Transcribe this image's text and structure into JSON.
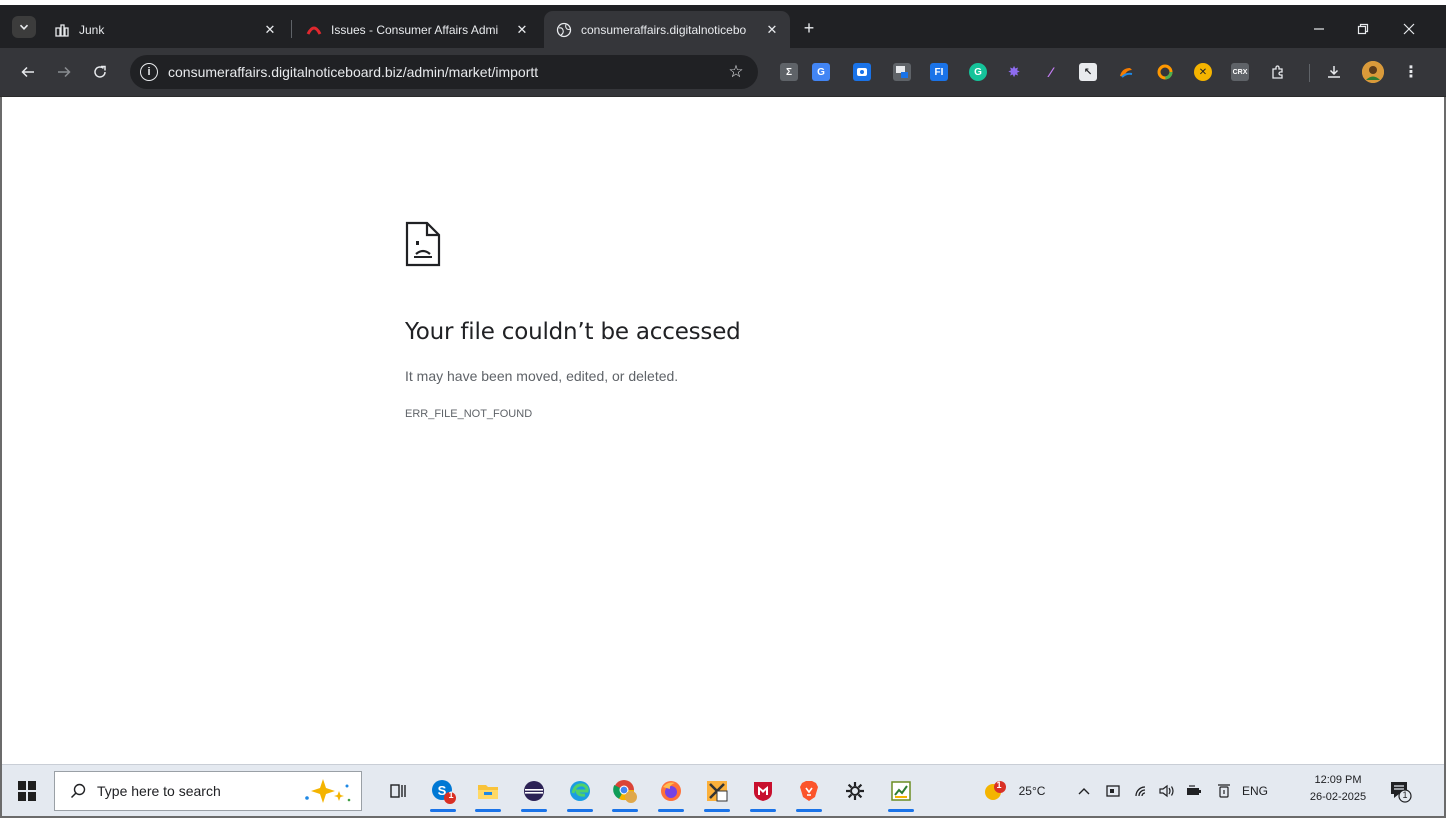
{
  "browser": {
    "tabs": [
      {
        "title": "Junk",
        "active": false
      },
      {
        "title": "Issues - Consumer Affairs Admi",
        "active": false
      },
      {
        "title": "consumeraffairs.digitalnoticebo",
        "active": true
      }
    ],
    "address_bar": {
      "url": "consumeraffairs.digitalnoticeboard.biz/admin/market/importt"
    },
    "extensions": [
      "sigma-extension-icon",
      "google-translate-icon",
      "screen-capture-icon",
      "window-resizer-icon",
      "fi-extension-icon",
      "grammarly-icon",
      "gear-purple-extension-icon",
      "feather-extension-icon",
      "cursor-extension-icon",
      "colorful-extension-icon",
      "circle-extension-icon",
      "cancel-extension-icon",
      "crx-extension-icon",
      "puzzle-extensions-icon"
    ]
  },
  "error_page": {
    "title": "Your file couldn’t be accessed",
    "message": "It may have been moved, edited, or deleted.",
    "code": "ERR_FILE_NOT_FOUND"
  },
  "taskbar": {
    "search_placeholder": "Type here to search",
    "skype_badge": "1",
    "weather_badge": "1",
    "temperature": "25°C",
    "language": "ENG",
    "time": "12:09 PM",
    "date": "26-02-2025",
    "notification_count": "1"
  },
  "colors": {
    "tabstrip": "#202124",
    "toolbar": "#35363a",
    "taskbar": "#e4e9f0",
    "error_title": "#202124",
    "error_text": "#5f6368"
  }
}
